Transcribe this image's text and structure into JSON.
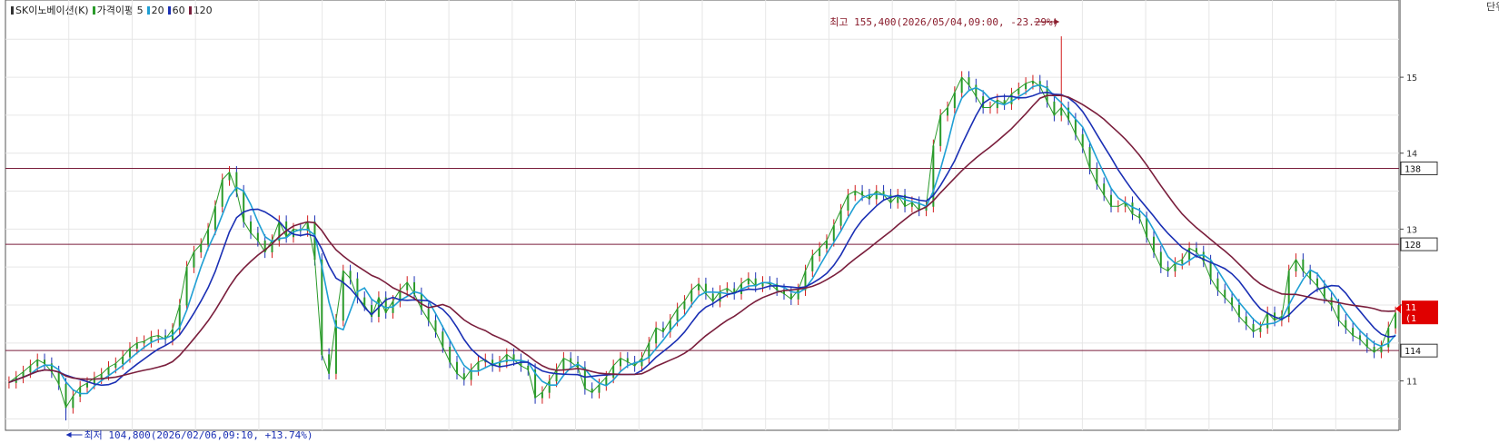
{
  "window": {
    "stock_name": "SK이노베이션(K)",
    "ma_label": "가격이평",
    "ma_periods": [
      "5",
      "20",
      "60",
      "120"
    ],
    "ma_colors": [
      "#2a9a2a",
      "#1f9fd4",
      "#1a2fb4",
      "#7a1e3c"
    ]
  },
  "annotations": {
    "high": "최고 155,400(2026/05/04,09:00, -23.29%)",
    "low": "최저 104,800(2026/02/06,09:10, +13.74%)"
  },
  "chart_data": {
    "type": "line",
    "title": "",
    "ylim": [
      103500,
      158500
    ],
    "grid": true,
    "y_ticks": [
      110000,
      120000,
      130000,
      140000,
      150000
    ],
    "y_tick_labels": [
      "11",
      "12",
      "13",
      "14",
      "15"
    ],
    "axis_top_label": "단위",
    "price_levels": [
      {
        "value": 138000,
        "label": "138"
      },
      {
        "value": 128000,
        "label": "128"
      },
      {
        "value": 114000,
        "label": "114"
      }
    ],
    "current_price": {
      "value": 119500,
      "label": "11",
      "label2": "(1"
    },
    "high": {
      "value": 155400,
      "index": 148
    },
    "low": {
      "value": 104800,
      "index": 8
    },
    "price_close": [
      109800,
      110500,
      111200,
      112000,
      112800,
      112300,
      111200,
      109600,
      106500,
      108000,
      109200,
      109700,
      110400,
      110900,
      111800,
      112300,
      113200,
      114300,
      115000,
      115200,
      115800,
      116000,
      115500,
      116800,
      120000,
      125000,
      127000,
      128000,
      130000,
      133000,
      136500,
      137500,
      135000,
      131000,
      129500,
      128500,
      127000,
      128500,
      131000,
      129000,
      130000,
      129800,
      131000,
      126000,
      113500,
      111000,
      118000,
      124500,
      123500,
      121000,
      120000,
      118500,
      121000,
      119000,
      120500,
      122000,
      123000,
      121500,
      119500,
      118000,
      116500,
      114500,
      112500,
      111000,
      110200,
      111500,
      112500,
      112800,
      112000,
      112500,
      113500,
      112800,
      112000,
      111500,
      107800,
      108500,
      110000,
      111500,
      113000,
      112500,
      111800,
      109000,
      108500,
      109500,
      110500,
      112000,
      113000,
      112500,
      112000,
      113000,
      115000,
      117000,
      116500,
      118000,
      119500,
      120500,
      122000,
      122800,
      121500,
      120500,
      121800,
      122200,
      121500,
      122800,
      123500,
      122500,
      123000,
      122800,
      122000,
      121500,
      120800,
      122000,
      124500,
      126500,
      127500,
      128500,
      130500,
      132500,
      134500,
      135000,
      134500,
      134000,
      135000,
      134500,
      133500,
      134500,
      133000,
      133500,
      132500,
      133000,
      141000,
      145000,
      146000,
      148000,
      150000,
      149000,
      147500,
      146000,
      146000,
      147000,
      146500,
      147800,
      148500,
      149200,
      149500,
      148800,
      146800,
      145000,
      146000,
      144500,
      142500,
      140800,
      138000,
      136000,
      134500,
      133000,
      133000,
      133500,
      132000,
      131500,
      129000,
      127000,
      125000,
      124500,
      125500,
      126000,
      127500,
      127000,
      125800,
      123500,
      122000,
      121000,
      120000,
      118500,
      117500,
      116500,
      117000,
      119000,
      118000,
      118500,
      124500,
      126000,
      124500,
      123500,
      122500,
      121000,
      120000,
      118000,
      117000,
      116000,
      115500,
      114500,
      113800,
      114500,
      117000,
      119000
    ],
    "series": [
      {
        "name": "5",
        "values": [
          109800,
          110500,
          111200,
          112000,
          112800,
          112300,
          111200,
          109600,
          106500,
          108000,
          109200,
          109700,
          110400,
          110900,
          111800,
          112300,
          113200,
          114300,
          115000,
          115200,
          115800,
          116000,
          115500,
          116800,
          120000,
          125000,
          127000,
          128000,
          130000,
          133000,
          136500,
          137500,
          135000,
          131000,
          129500,
          128500,
          127000,
          128500,
          131000,
          129000,
          130000,
          129800,
          131000,
          126000,
          113500,
          111000,
          118000,
          124500,
          123500,
          121000,
          120000,
          118500,
          121000,
          119000,
          120500,
          122000,
          123000,
          121500,
          119500,
          118000,
          116500,
          114500,
          112500,
          111000,
          110200,
          111500,
          112500,
          112800,
          112000,
          112500,
          113500,
          112800,
          112000,
          111500,
          107800,
          108500,
          110000,
          111500,
          113000,
          112500,
          111800,
          109000,
          108500,
          109500,
          110500,
          112000,
          113000,
          112500,
          112000,
          113000,
          115000,
          117000,
          116500,
          118000,
          119500,
          120500,
          122000,
          122800,
          121500,
          120500,
          121800,
          122200,
          121500,
          122800,
          123500,
          122500,
          123000,
          122800,
          122000,
          121500,
          120800,
          122000,
          124500,
          126500,
          127500,
          128500,
          130500,
          132500,
          134500,
          135000,
          134500,
          134000,
          135000,
          134500,
          133500,
          134500,
          133000,
          133500,
          132500,
          133000,
          141000,
          145000,
          146000,
          148000,
          150000,
          149000,
          147500,
          146000,
          146000,
          147000,
          146500,
          147800,
          148500,
          149200,
          149500,
          148800,
          146800,
          145000,
          146000,
          144500,
          142500,
          140800,
          138000,
          136000,
          134500,
          133000,
          133000,
          133500,
          132000,
          131500,
          129000,
          127000,
          125000,
          124500,
          125500,
          126000,
          127500,
          127000,
          125800,
          123500,
          122000,
          121000,
          120000,
          118500,
          117500,
          116500,
          117000,
          119000,
          118000,
          118500,
          124500,
          126000,
          124500,
          123500,
          122500,
          121000,
          120000,
          118000,
          117000,
          116000,
          115500,
          114500,
          113800,
          114500,
          117000,
          119000
        ]
      },
      {
        "name": "20",
        "period": 4
      },
      {
        "name": "60",
        "period": 8
      },
      {
        "name": "120",
        "period": 16
      }
    ]
  }
}
